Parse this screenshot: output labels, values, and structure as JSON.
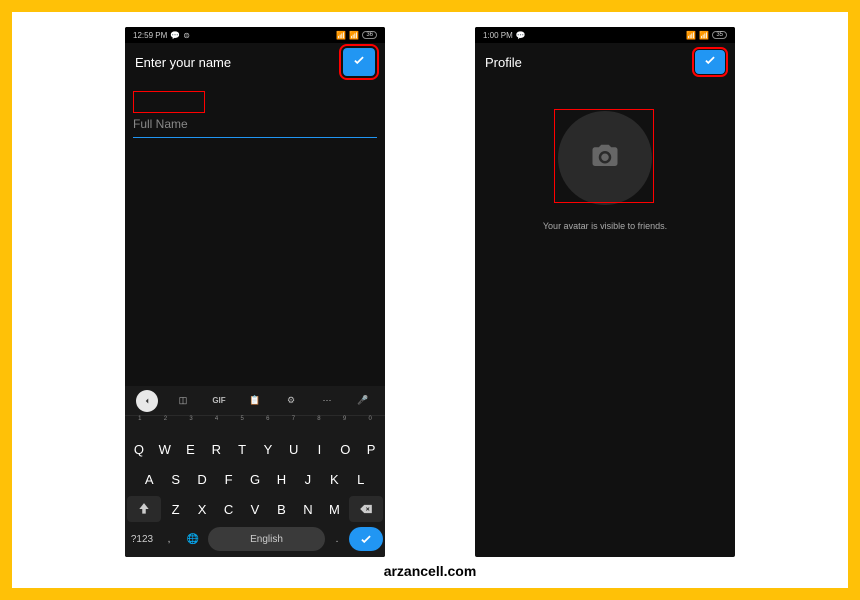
{
  "phone1": {
    "status": {
      "time": "12:59 PM",
      "battery": "36"
    },
    "header": {
      "title": "Enter your name"
    },
    "input": {
      "placeholder": "Full Name",
      "value": ""
    },
    "keyboard": {
      "toolbar_gif": "GIF",
      "number_row": [
        "1",
        "2",
        "3",
        "4",
        "5",
        "6",
        "7",
        "8",
        "9",
        "0"
      ],
      "row1": [
        "Q",
        "W",
        "E",
        "R",
        "T",
        "Y",
        "U",
        "I",
        "O",
        "P"
      ],
      "row2": [
        "A",
        "S",
        "D",
        "F",
        "G",
        "H",
        "J",
        "K",
        "L"
      ],
      "row3": [
        "Z",
        "X",
        "C",
        "V",
        "B",
        "N",
        "M"
      ],
      "symbols": "?123",
      "comma": ",",
      "space": "English",
      "dot": "."
    }
  },
  "phone2": {
    "status": {
      "time": "1:00 PM",
      "battery": "35"
    },
    "header": {
      "title": "Profile"
    },
    "avatar_text": "Your avatar is visible to friends."
  },
  "footer": {
    "text": "arzancell.com"
  }
}
